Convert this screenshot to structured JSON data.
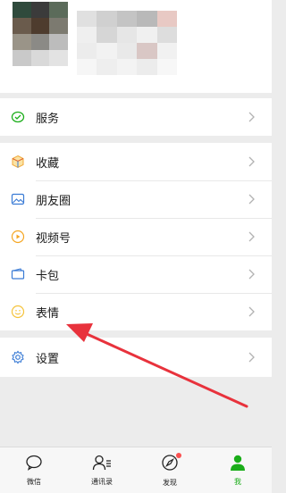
{
  "profile": {
    "mosaic_colors": [
      "#2f4a3c",
      "#3b3b3b",
      "#5b6b5a",
      "#6a5b4c",
      "#4e3c2e",
      "#7c7a70",
      "#9a9488",
      "#8b8a86",
      "#bcbcbc",
      "#c9c9c9",
      "#d9d9d9",
      "#e3e3e3"
    ],
    "mosaic2_colors": [
      "#e0e0e0",
      "#d0d0d0",
      "#c4c4c4",
      "#b9b9b9",
      "#e8c9c4",
      "#efefef",
      "#d6d6d6",
      "#e6e6e6",
      "#f0f0f0",
      "#dddddd",
      "#ececec",
      "#f2f2f2",
      "#e9e9e9",
      "#d9c7c5",
      "#f1f1f1",
      "#f6f6f6",
      "#eeeeee",
      "#f3f3f3",
      "#ececec",
      "#f7f7f7"
    ]
  },
  "menu": {
    "services": {
      "label": "服务",
      "icon": "wechat-pay-icon"
    },
    "favorites": {
      "label": "收藏",
      "icon": "cube-icon"
    },
    "moments": {
      "label": "朋友圈",
      "icon": "image-icon"
    },
    "channels": {
      "label": "视频号",
      "icon": "play-circle-icon"
    },
    "cards": {
      "label": "卡包",
      "icon": "wallet-icon"
    },
    "stickers": {
      "label": "表情",
      "icon": "smile-icon"
    },
    "settings": {
      "label": "设置",
      "icon": "gear-icon"
    }
  },
  "tabbar": {
    "chats": "微信",
    "contacts": "通讯录",
    "discover": "发现",
    "me": "我"
  },
  "colors": {
    "accent_green": "#1aad19",
    "annotation_red": "#e8323c",
    "badge_red": "#fa5151"
  }
}
